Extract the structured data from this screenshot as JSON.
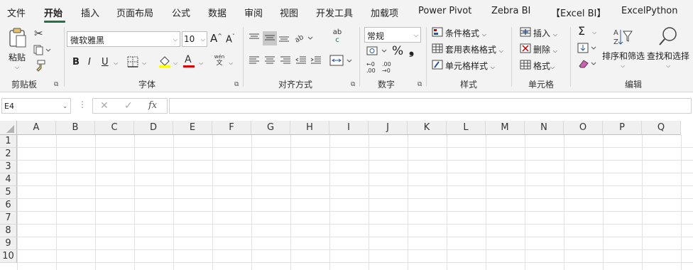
{
  "tabs": [
    "文件",
    "开始",
    "插入",
    "页面布局",
    "公式",
    "数据",
    "审阅",
    "视图",
    "开发工具",
    "加载项",
    "Power Pivot",
    "Zebra BI",
    "【Excel BI】",
    "ExcelPython"
  ],
  "active_tab": "开始",
  "accent_color": "#217346",
  "clipboard": {
    "paste_label": "粘贴",
    "group_label": "剪贴板",
    "icons": [
      "paste-icon",
      "cut-icon",
      "copy-icon",
      "format-painter-icon"
    ]
  },
  "font": {
    "font_name": "微软雅黑",
    "font_size": "10",
    "grow_label": "A",
    "shrink_label": "A",
    "bold": "B",
    "italic": "I",
    "underline": "U",
    "color_letter": "A",
    "phonetic_top": "wén",
    "phonetic_bottom": "文",
    "group_label": "字体",
    "fill_color": "#ffff00",
    "font_color": "#e00000"
  },
  "alignment": {
    "group_label": "对齐方式",
    "wrap_top": "ab",
    "wrap_bottom": "c"
  },
  "number": {
    "format": "常规",
    "percent": "%",
    "comma": "❟",
    "group_label": "数字",
    "inc_decimal_top": "←0",
    "inc_decimal_bottom": ".00",
    "dec_decimal_top": ".00",
    "dec_decimal_bottom": "→0"
  },
  "styles": {
    "conditional": "条件格式",
    "table": "套用表格格式",
    "cell_styles": "单元格样式",
    "group_label": "样式"
  },
  "cells_group": {
    "insert": "插入",
    "delete": "删除",
    "format": "格式",
    "group_label": "单元格"
  },
  "editing": {
    "sort_filter": "排序和筛选",
    "find_select": "查找和选择",
    "group_label": "编辑"
  },
  "formula_bar": {
    "name_box": "E4",
    "fx": "fx",
    "formula": ""
  },
  "grid": {
    "columns": [
      "A",
      "B",
      "C",
      "D",
      "E",
      "F",
      "G",
      "H",
      "I",
      "J",
      "K",
      "L",
      "M",
      "N",
      "O",
      "P",
      "Q"
    ],
    "rows": [
      "1",
      "2",
      "3",
      "4",
      "5",
      "6",
      "7",
      "8",
      "9",
      "10"
    ]
  }
}
